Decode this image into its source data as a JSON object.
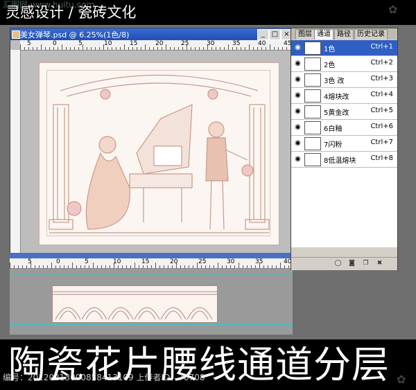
{
  "header": {
    "title": "灵感设计 / 瓷砖文化",
    "watermark": "汇图网 www.huitu.com"
  },
  "document": {
    "title": "美女弹琴.psd @ 6.25%(1色/8)",
    "buttons": {
      "minimize": "_",
      "maximize": "□",
      "close": "×"
    },
    "ruler_labels": [
      "5",
      "0",
      "5",
      "10",
      "15",
      "20",
      "25",
      "30",
      "35",
      "40",
      "45"
    ]
  },
  "document2": {
    "ruler_labels": [
      "5",
      "0",
      "5",
      "10",
      "15",
      "20",
      "25",
      "30",
      "35",
      "40"
    ]
  },
  "panel": {
    "tabs": [
      "图层",
      "通道",
      "路径",
      "历史记录"
    ],
    "active_tab": 1,
    "channels": [
      {
        "name": "1色",
        "shortcut": "Ctrl+1",
        "selected": true
      },
      {
        "name": "2色",
        "shortcut": "Ctrl+2",
        "selected": false
      },
      {
        "name": "3色 改",
        "shortcut": "Ctrl+3",
        "selected": false
      },
      {
        "name": "4熔块改",
        "shortcut": "Ctrl+4",
        "selected": false
      },
      {
        "name": "5黄金改",
        "shortcut": "Ctrl+5",
        "selected": false
      },
      {
        "name": "6白釉",
        "shortcut": "Ctrl+6",
        "selected": false
      },
      {
        "name": "7闪粉",
        "shortcut": "Ctrl+7",
        "selected": false
      },
      {
        "name": "8低温熔块",
        "shortcut": "Ctrl+8",
        "selected": false
      }
    ]
  },
  "footer": {
    "title": "陶瓷花片腰线通道分层",
    "caption": "编号：20120213000858413109 上传者ID：70708"
  },
  "colors": {
    "selection": "#2f5fc2",
    "canvas_line": "#c89a88",
    "guide": "#30c9d4"
  }
}
